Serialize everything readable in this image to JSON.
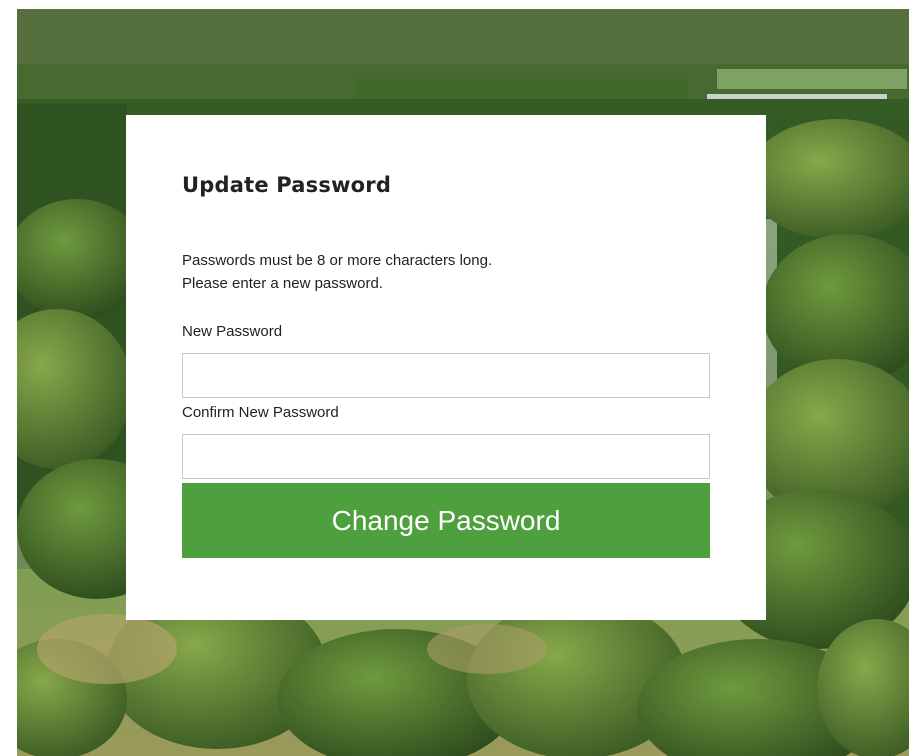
{
  "form": {
    "title": "Update Password",
    "info_line_1": "Passwords must be 8 or more characters long.",
    "info_line_2": "Please enter a new password.",
    "new_password_label": "New Password",
    "new_password_value": "",
    "confirm_password_label": "Confirm New Password",
    "confirm_password_value": "",
    "submit_label": "Change Password"
  },
  "colors": {
    "button_background": "#4e9f3d",
    "button_text": "#ffffff",
    "card_background": "#ffffff",
    "text": "#222222",
    "input_border": "#c8c8c8"
  }
}
